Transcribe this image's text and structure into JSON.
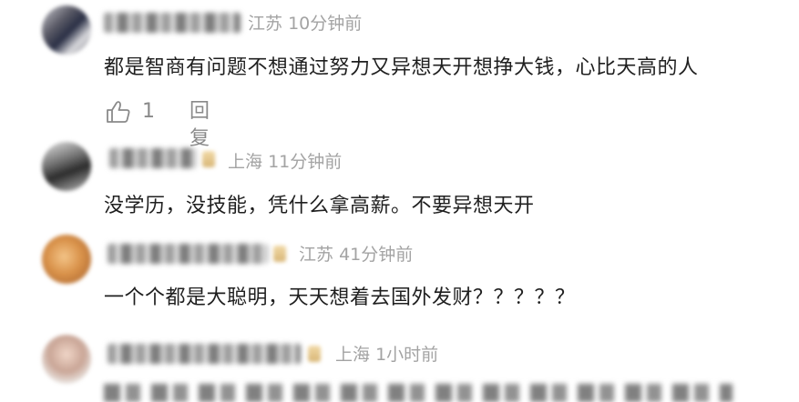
{
  "comments": [
    {
      "location": "江苏",
      "time": "10分钟前",
      "text": "都是智商有问题不想通过努力又异想天开想挣大钱，心比天高的人",
      "likes": "1",
      "reply_label": "回复"
    },
    {
      "location": "上海",
      "time": "11分钟前",
      "text": "没学历，没技能，凭什么拿高薪。不要异想天开"
    },
    {
      "location": "江苏",
      "time": "41分钟前",
      "text": "一个个都是大聪明，天天想着去国外发财？？？？？"
    },
    {
      "location": "上海",
      "time": "1小时前",
      "text": ""
    }
  ],
  "icons": {
    "like": "thumbs-up-icon"
  }
}
